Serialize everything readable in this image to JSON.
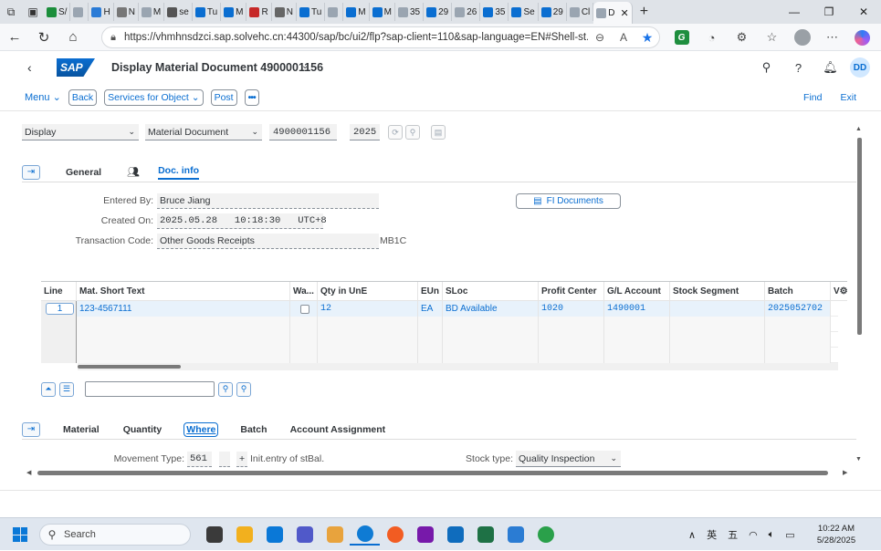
{
  "browser": {
    "tabs": [
      {
        "label": "S/",
        "color": "#1b8e3b"
      },
      {
        "label": "",
        "color": "#9aa5b1"
      },
      {
        "label": "H",
        "color": "#2a7bd6"
      },
      {
        "label": "N",
        "color": "#777777"
      },
      {
        "label": "M",
        "color": "#9aa5b1"
      },
      {
        "label": "se",
        "color": "#555555"
      },
      {
        "label": "Tu",
        "color": "#0a6ed1"
      },
      {
        "label": "M",
        "color": "#0a6ed1"
      },
      {
        "label": "R",
        "color": "#c62828"
      },
      {
        "label": "N",
        "color": "#666666"
      },
      {
        "label": "Tu",
        "color": "#0a6ed1"
      },
      {
        "label": "",
        "color": "#9aa5b1"
      },
      {
        "label": "M",
        "color": "#0a6ed1"
      },
      {
        "label": "M",
        "color": "#0a6ed1"
      },
      {
        "label": "35",
        "color": "#9aa5b1"
      },
      {
        "label": "29",
        "color": "#0a6ed1"
      },
      {
        "label": "26",
        "color": "#9aa5b1"
      },
      {
        "label": "35",
        "color": "#0a6ed1"
      },
      {
        "label": "Se",
        "color": "#0a6ed1"
      },
      {
        "label": "29",
        "color": "#0a6ed1"
      },
      {
        "label": "Cl",
        "color": "#9aa5b1"
      }
    ],
    "active_tab": {
      "label": "D",
      "close": "✕"
    },
    "new_tab": "+",
    "url": "https://vhmhnsdzci.sap.solvehc.cn:44300/sap/bc/ui2/flp?sap-client=110&sap-language=EN#Shell-st...",
    "ext_label": "G"
  },
  "shell": {
    "logo": "SAP",
    "title": "Display Material Document 4900001156",
    "user_initials": "DD"
  },
  "toolbar": {
    "menu": "Menu",
    "buttons": [
      "Back",
      "Services for Object",
      "Post",
      "•••"
    ],
    "find": "Find",
    "exit": "Exit"
  },
  "selection": {
    "mode": "Display",
    "doc_type": "Material Document",
    "doc_number": "4900001156",
    "year": "2025"
  },
  "header_tabs": {
    "general": "General",
    "doc_info": "Doc. info"
  },
  "doc_info": {
    "entered_by_label": "Entered By:",
    "entered_by": "Bruce Jiang",
    "created_on_label": "Created On:",
    "created_on": "2025.05.28   10:18:30   UTC+8",
    "trans_code_label": "Transaction Code:",
    "trans_code": "Other Goods Receipts",
    "tcode": "MB1C",
    "fi_button": "FI Documents"
  },
  "items_table": {
    "columns": [
      "Line",
      "Mat. Short Text",
      "Wa...",
      "Qty in UnE",
      "EUn",
      "SLoc",
      "Profit Center",
      "G/L Account",
      "Stock Segment",
      "Batch",
      "V"
    ],
    "rows": [
      {
        "line": "1",
        "text": "123-4567111",
        "wa": "",
        "qty": "12",
        "eun": "EA",
        "sloc": "BD Available",
        "profit_center": "1020",
        "gl": "1490001",
        "segment": "",
        "batch": "2025052702"
      }
    ]
  },
  "item_tabs": {
    "material": "Material",
    "quantity": "Quantity",
    "where": "Where",
    "batch": "Batch",
    "account": "Account Assignment"
  },
  "where_fields": {
    "movement_type_label": "Movement Type:",
    "movement_type": "561",
    "plus": "+",
    "movement_text": "Init.entry of stBal.",
    "stock_type_label": "Stock type:",
    "stock_type": "Quality Inspection"
  },
  "taskbar": {
    "search_placeholder": "Search",
    "tray_lang1": "英",
    "tray_lang2": "五",
    "time": "10:22 AM",
    "date": "5/28/2025",
    "app_colors": [
      "#3a3a3a",
      "#f2b01e",
      "#0a78d7",
      "#5059c9",
      "#e8a33d",
      "#0f7bd4",
      "#f25c22",
      "#7719aa",
      "#0f6cbd",
      "#1e7145",
      "#2b7cd3",
      "#2aa04a"
    ]
  }
}
